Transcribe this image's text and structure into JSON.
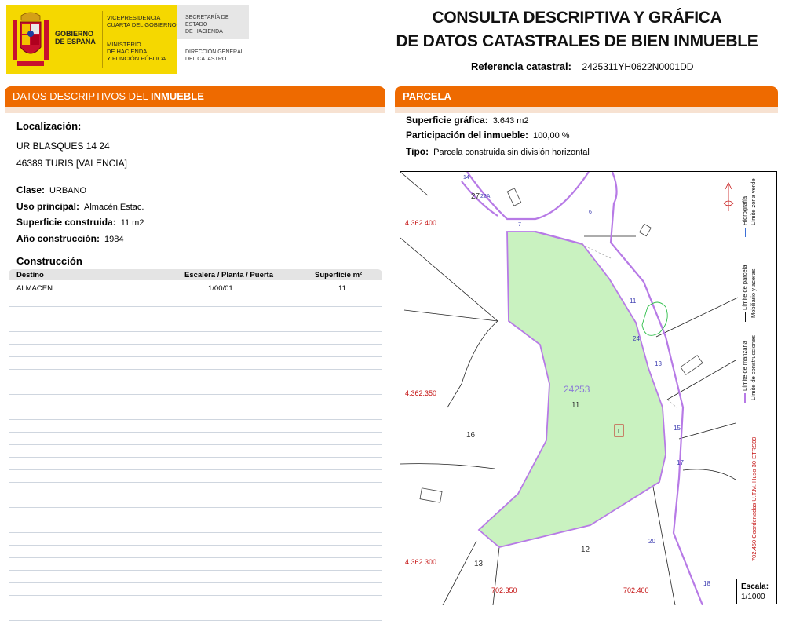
{
  "header": {
    "gobierno": [
      "GOBIERNO",
      "DE ESPAÑA"
    ],
    "vicepresidencia": [
      "VICEPRESIDENCIA",
      "CUARTA DEL GOBIERNO"
    ],
    "ministerio": [
      "MINISTERIO",
      "DE HACIENDA",
      "Y FUNCIÓN PÚBLICA"
    ],
    "secretaria": [
      "SECRETARÍA DE ESTADO",
      "DE HACIENDA"
    ],
    "direccion": [
      "DIRECCIÓN GENERAL",
      "DEL CATASTRO"
    ],
    "title_line1": "CONSULTA DESCRIPTIVA Y GRÁFICA",
    "title_line2": "DE DATOS CATASTRALES DE BIEN INMUEBLE",
    "ref_label": "Referencia catastral:",
    "ref_value": "2425311YH0622N0001DD"
  },
  "colors": {
    "accent": "#ee6a00",
    "brand_yellow": "#f5d800",
    "parcel_fill": "#c9f2c0",
    "parcel_border": "#b77ae6",
    "coords": "#c41010"
  },
  "left": {
    "bar_prefix": "DATOS DESCRIPTIVOS DEL ",
    "bar_bold": "INMUEBLE",
    "localizacion_label": "Localización:",
    "address_line1": "UR BLASQUES 14 24",
    "address_line2": "46389 TURIS [VALENCIA]",
    "clase_label": "Clase:",
    "clase_value": "URBANO",
    "uso_label": "Uso principal:",
    "uso_value": "Almacén,Estac.",
    "superficie_label": "Superficie construida:",
    "superficie_value": "11 m2",
    "anio_label": "Año construcción:",
    "anio_value": "1984",
    "construccion_label": "Construcción",
    "table": {
      "headers": [
        "Destino",
        "Escalera / Planta / Puerta",
        "Superficie m²"
      ],
      "rows": [
        [
          "ALMACEN",
          "1/00/01",
          "11"
        ]
      ]
    }
  },
  "right": {
    "bar_label": "PARCELA",
    "sup_grafica_label": "Superficie gráfica:",
    "sup_grafica_value": "3.643 m2",
    "participacion_label": "Participación del inmueble:",
    "participacion_value": "100,00 %",
    "tipo_label": "Tipo:",
    "tipo_value": "Parcela construida sin división horizontal"
  },
  "map": {
    "y_coords": [
      "4.362.400",
      "4.362.350",
      "4.362.300"
    ],
    "x_coords": [
      "702.350",
      "702.400"
    ],
    "parcel_ref": "24253",
    "parcel_number": "11",
    "neighbor_labels": [
      "27",
      "16",
      "13",
      "12"
    ],
    "street_numbers": [
      "14",
      "22A",
      "7",
      "11",
      "24",
      "13",
      "15",
      "17",
      "20",
      "18",
      "6"
    ],
    "scale_label": "Escala:",
    "scale_value": "1/1000",
    "coords_note": "702.450 Coordenadas U.T.M. Huso 30 ETRS89",
    "legend": [
      {
        "text": "Límite de manzana",
        "color": "#b77ae6"
      },
      {
        "text": "Límite de construcciones",
        "color": "#d64aa8"
      },
      {
        "text": "Límite de parcela",
        "color": "#111111"
      },
      {
        "text": "Mobiliario y aceras",
        "color": "#888888"
      },
      {
        "text": "Hidrografía",
        "color": "#3c6fd6"
      },
      {
        "text": "Límite zona verde",
        "color": "#2fbf4a"
      }
    ]
  }
}
